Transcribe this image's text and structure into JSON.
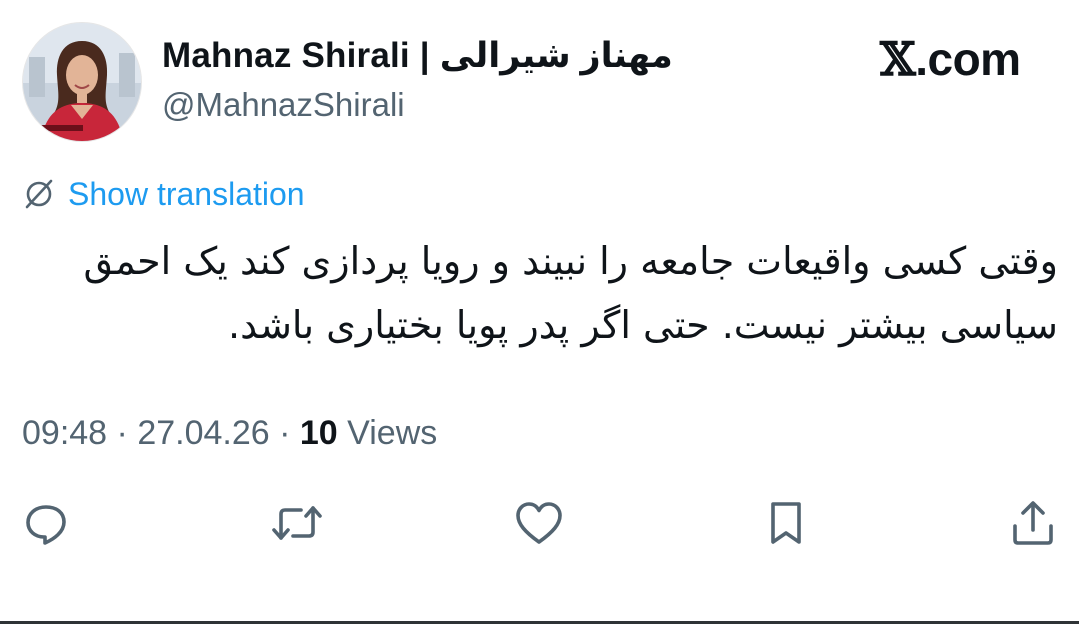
{
  "author": {
    "display_name": "Mahnaz Shirali | مهناز شیرالی",
    "handle": "@MahnazShirali",
    "avatar_icon": "profile-photo"
  },
  "site": {
    "label_x": "𝕏",
    "label_rest": ".com"
  },
  "translation": {
    "label": "Show translation",
    "icon": "globe-slash-icon"
  },
  "tweet": {
    "text": "وقتی کسی واقیعات جامعه را نبیند و رویا پردازی کند یک احمق سیاسی بیشتر نیست. حتی اگر پدر پویا بختیاری باشد."
  },
  "meta": {
    "time": "09:48",
    "separator": " · ",
    "date": "27.04.26",
    "views_count": "10",
    "views_label": "Views"
  },
  "actions": {
    "reply": "reply-icon",
    "repost": "repost-icon",
    "like": "like-icon",
    "bookmark": "bookmark-icon",
    "share": "share-icon"
  },
  "colors": {
    "link": "#1d9bf0",
    "secondary_text": "#536471",
    "primary_text": "#0f1419"
  }
}
